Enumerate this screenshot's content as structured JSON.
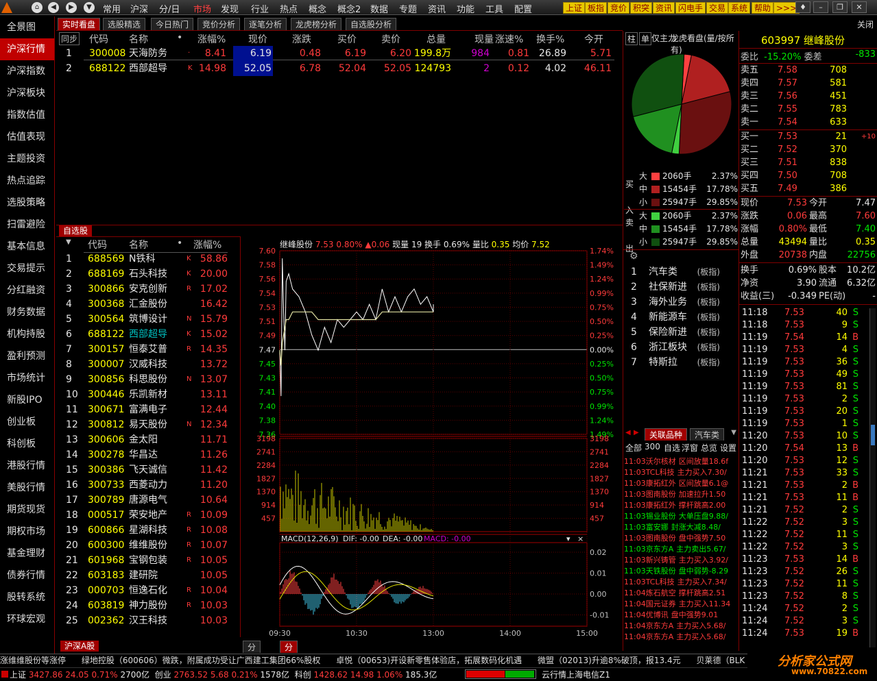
{
  "topbar": {
    "menus": [
      "常用",
      "沪深",
      "分/日",
      "市场",
      "发现",
      "行业",
      "热点",
      "概念",
      "概念2",
      "数据",
      "专题",
      "资讯",
      "功能",
      "工具",
      "配置"
    ],
    "active_menu": "市场",
    "right_buttons": [
      "上证",
      "板指",
      "竞价",
      "积突",
      "资讯",
      "闪电手",
      "交易",
      "系统",
      "帮助",
      ">>>"
    ],
    "close_label": "关闭"
  },
  "sidebar": {
    "items": [
      "全景图",
      "沪深行情",
      "沪深指数",
      "沪深板块",
      "指数估值",
      "估值表现",
      "主题投资",
      "热点追踪",
      "选股策略",
      "扫雷避险",
      "基本信息",
      "交易提示",
      "分红融资",
      "财务数据",
      "机构持股",
      "盈利预测",
      "市场统计",
      "新股IPO",
      "创业板",
      "科创板",
      "港股行情",
      "美股行情",
      "期货现货",
      "期权市场",
      "基金理财",
      "债券行情",
      "股转系统",
      "环球宏观"
    ],
    "active": 1
  },
  "top_tabs": [
    "实时看盘",
    "选股精选",
    "今日热门",
    "竞价分析",
    "逐笔分析",
    "龙虎榜分析",
    "自选股分析"
  ],
  "watch_table": {
    "headers": [
      "同步",
      "代码",
      "名称",
      "•",
      "涨幅%",
      "现价",
      "涨跌",
      "买价",
      "卖价",
      "总量",
      "现量",
      "涨速%",
      "换手%",
      "今开"
    ],
    "rows": [
      {
        "idx": "1",
        "code": "300008",
        "name": "天海防务",
        "flag": "·",
        "pct": "8.41",
        "price": "6.19",
        "chg": "0.48",
        "bid": "6.19",
        "ask": "6.20",
        "vol": "199.8万",
        "cur": "984",
        "speed": "0.81",
        "turn": "26.89",
        "open": "5.71"
      },
      {
        "idx": "2",
        "code": "688122",
        "name": "西部超导",
        "flag": "K",
        "pct": "14.98",
        "price": "52.05",
        "chg": "6.78",
        "bid": "52.04",
        "ask": "52.05",
        "vol": "124793",
        "cur": "2",
        "speed": "0.12",
        "turn": "4.02",
        "open": "46.11"
      }
    ]
  },
  "self_panel": {
    "title": "自选股",
    "headers": [
      "代码",
      "名称",
      "•",
      "涨幅%"
    ],
    "rows": [
      {
        "idx": "1",
        "code": "688569",
        "name": "N铁科",
        "flag": "K",
        "pct": "58.86"
      },
      {
        "idx": "2",
        "code": "688169",
        "name": "石头科技",
        "flag": "K",
        "pct": "20.00"
      },
      {
        "idx": "3",
        "code": "300866",
        "name": "安克创新",
        "flag": "R",
        "pct": "17.02"
      },
      {
        "idx": "4",
        "code": "300368",
        "name": "汇金股份",
        "flag": "",
        "pct": "16.42"
      },
      {
        "idx": "5",
        "code": "300564",
        "name": "筑博设计",
        "flag": "N",
        "pct": "15.79"
      },
      {
        "idx": "6",
        "code": "688122",
        "name": "西部超导",
        "flag": "K",
        "pct": "15.02"
      },
      {
        "idx": "7",
        "code": "300157",
        "name": "恒泰艾普",
        "flag": "R",
        "pct": "14.35"
      },
      {
        "idx": "8",
        "code": "300007",
        "name": "汉威科技",
        "flag": "",
        "pct": "13.72"
      },
      {
        "idx": "9",
        "code": "300856",
        "name": "科思股份",
        "flag": "N",
        "pct": "13.07"
      },
      {
        "idx": "10",
        "code": "300446",
        "name": "乐凯新材",
        "flag": "",
        "pct": "13.11"
      },
      {
        "idx": "11",
        "code": "300671",
        "name": "富满电子",
        "flag": "",
        "pct": "12.44"
      },
      {
        "idx": "12",
        "code": "300812",
        "name": "易天股份",
        "flag": "N",
        "pct": "12.34"
      },
      {
        "idx": "13",
        "code": "300606",
        "name": "金太阳",
        "flag": "",
        "pct": "11.71"
      },
      {
        "idx": "14",
        "code": "300278",
        "name": "华昌达",
        "flag": "",
        "pct": "11.26"
      },
      {
        "idx": "15",
        "code": "300386",
        "name": "飞天诚信",
        "flag": "",
        "pct": "11.42"
      },
      {
        "idx": "16",
        "code": "300733",
        "name": "西菱动力",
        "flag": "",
        "pct": "11.20"
      },
      {
        "idx": "17",
        "code": "300789",
        "name": "唐源电气",
        "flag": "",
        "pct": "10.64"
      },
      {
        "idx": "18",
        "code": "000517",
        "name": "荣安地产",
        "flag": "R",
        "pct": "10.09"
      },
      {
        "idx": "19",
        "code": "600866",
        "name": "星湖科技",
        "flag": "R",
        "pct": "10.08"
      },
      {
        "idx": "20",
        "code": "600300",
        "name": "维维股份",
        "flag": "R",
        "pct": "10.07"
      },
      {
        "idx": "21",
        "code": "601968",
        "name": "宝钢包装",
        "flag": "R",
        "pct": "10.05"
      },
      {
        "idx": "22",
        "code": "603183",
        "name": "建研院",
        "flag": "",
        "pct": "10.05"
      },
      {
        "idx": "23",
        "code": "000703",
        "name": "恒逸石化",
        "flag": "R",
        "pct": "10.04"
      },
      {
        "idx": "24",
        "code": "603819",
        "name": "神力股份",
        "flag": "R",
        "pct": "10.03"
      },
      {
        "idx": "25",
        "code": "002362",
        "name": "汉王科技",
        "flag": "",
        "pct": "10.03"
      }
    ],
    "bottom_tab": "沪深A股"
  },
  "intraday": {
    "header": {
      "name": "继峰股份",
      "price": "7.53",
      "pct": "0.80%",
      "chg": "▲0.06",
      "cur_vol": "现量 19",
      "turnover": "换手 0.69%",
      "vol_ratio_label": "量比",
      "vol_ratio": "0.35",
      "avg_label": "均价",
      "avg": "7.52"
    },
    "price_ticks": [
      "7.60",
      "7.58",
      "7.56",
      "7.54",
      "7.53",
      "7.51",
      "7.49",
      "7.47",
      "7.45",
      "7.43",
      "7.41",
      "7.40",
      "7.38",
      "7.36"
    ],
    "pct_ticks": [
      "1.74%",
      "1.49%",
      "1.24%",
      "0.99%",
      "0.75%",
      "0.50%",
      "0.25%",
      "0.00%",
      "0.25%",
      "0.50%",
      "0.75%",
      "0.99%",
      "1.24%",
      "1.49%"
    ],
    "vol_ticks": [
      "3198",
      "2741",
      "2284",
      "1827",
      "1370",
      "914",
      "457"
    ],
    "macd_header": {
      "label": "MACD(12,26,9)",
      "dif": "DIF: -0.00",
      "dea": "DEA: -0.00",
      "macd": "MACD: -0.00"
    },
    "macd_ticks": [
      "0.02",
      "0.01",
      "0.00",
      "-0.01"
    ],
    "time_ticks": [
      "09:30",
      "10:30",
      "13:00",
      "14:00",
      "15:00"
    ],
    "bottom_tabs": [
      "分析图",
      "分时图"
    ]
  },
  "chart_data": {
    "type": "line",
    "title": "继峰股份",
    "x_label": "",
    "y_label": "",
    "ylim": [
      7.36,
      7.6
    ],
    "x": [
      "09:30",
      "09:31",
      "09:32",
      "09:33",
      "09:34",
      "09:35",
      "09:37",
      "09:40",
      "09:45",
      "09:50",
      "09:55",
      "10:00",
      "10:05",
      "10:10",
      "10:15",
      "10:20",
      "10:25",
      "10:30",
      "10:35",
      "10:40",
      "10:45",
      "10:50",
      "10:55",
      "11:00",
      "11:05",
      "11:10",
      "11:15",
      "11:20",
      "11:25",
      "11:30",
      "13:00"
    ],
    "series": [
      {
        "name": "",
        "values": [
          7.47,
          7.41,
          7.59,
          7.52,
          7.47,
          7.56,
          7.57,
          7.55,
          7.54,
          7.52,
          7.49,
          7.47,
          7.5,
          7.48,
          7.51,
          7.5,
          7.51,
          7.52,
          7.51,
          7.53,
          7.51,
          7.55,
          7.52,
          7.54,
          7.52,
          7.54,
          7.55,
          7.53,
          7.54,
          7.52,
          7.53
        ]
      },
      {
        "name": "",
        "values": [
          7.47,
          7.45,
          7.48,
          7.49,
          7.5,
          7.51,
          7.51,
          7.52,
          7.52,
          7.52,
          7.52,
          7.51,
          7.51,
          7.51,
          7.51,
          7.51,
          7.51,
          7.51,
          7.51,
          7.51,
          7.51,
          7.52,
          7.52,
          7.52,
          7.52,
          7.52,
          7.52,
          7.52,
          7.52,
          7.52,
          7.52
        ]
      }
    ]
  },
  "mid_panel": {
    "tabs": [
      "柱",
      "单",
      "仅主力",
      "龙虎看盘(量/按所有)"
    ],
    "pie": [
      {
        "label": "大",
        "color": "#ff4040",
        "value": 2.37
      },
      {
        "label": "中",
        "color": "#b02020",
        "value": 17.78
      },
      {
        "label": "小",
        "color": "#6a1010",
        "value": 29.85
      },
      {
        "label": "大",
        "color": "#40d040",
        "value": 2.37
      },
      {
        "label": "中",
        "color": "#209020",
        "value": 17.78
      },
      {
        "label": "小",
        "color": "#105010",
        "value": 29.85
      }
    ],
    "buy_label": "买入",
    "sell_label": "卖出",
    "buy_rows": [
      {
        "size": "大",
        "vol": "2060手",
        "pct": "2.37%",
        "color": "#ff4040"
      },
      {
        "size": "中",
        "vol": "15454手",
        "pct": "17.78%",
        "color": "#b02020"
      },
      {
        "size": "小",
        "vol": "25947手",
        "pct": "29.85%",
        "color": "#6a1010"
      }
    ],
    "sell_rows": [
      {
        "size": "大",
        "vol": "2060手",
        "pct": "2.37%",
        "color": "#40d040"
      },
      {
        "size": "中",
        "vol": "15454手",
        "pct": "17.78%",
        "color": "#209020"
      },
      {
        "size": "小",
        "vol": "25947手",
        "pct": "29.85%",
        "color": "#105010"
      }
    ],
    "sectors": [
      {
        "idx": "1",
        "name": "汽车类",
        "type": "(板指)"
      },
      {
        "idx": "2",
        "name": "社保新进",
        "type": "(板指)"
      },
      {
        "idx": "3",
        "name": "海外业务",
        "type": "(板指)"
      },
      {
        "idx": "4",
        "name": "新能源车",
        "type": "(板指)"
      },
      {
        "idx": "5",
        "name": "保险新进",
        "type": "(板指)"
      },
      {
        "idx": "6",
        "name": "浙江板块",
        "type": "(板指)"
      },
      {
        "idx": "7",
        "name": "特斯拉",
        "type": "(板指)"
      }
    ],
    "related_tabs": [
      "关联品种",
      "汽车类"
    ],
    "filter_tabs": [
      "全部",
      "300",
      "自选",
      "浮窗",
      "总览",
      "设置"
    ],
    "news": [
      {
        "time": "11:03",
        "name": "沃尔核材",
        "event": "区间放量",
        "val": "18.6f",
        "color": "red"
      },
      {
        "time": "11:03",
        "name": "TCL科技",
        "event": "主力买入",
        "val": "7.30/",
        "color": "red"
      },
      {
        "time": "11:03",
        "name": "康拓红外",
        "event": "区间放量",
        "val": "6.1@",
        "color": "red"
      },
      {
        "time": "11:03",
        "name": "图南股份",
        "event": "加速拉升",
        "val": "1.50",
        "color": "red"
      },
      {
        "time": "11:03",
        "name": "康拓红外",
        "event": "撑杆跳高",
        "val": "2.00",
        "color": "red"
      },
      {
        "time": "11:03",
        "name": "锡业股份",
        "event": "大单压盘",
        "val": "9.88/",
        "color": "green"
      },
      {
        "time": "11:03",
        "name": "富安娜",
        "event": "封涨大减",
        "val": "8.48/",
        "color": "green"
      },
      {
        "time": "11:03",
        "name": "图南股份",
        "event": "盘中强势",
        "val": "7.50",
        "color": "red"
      },
      {
        "time": "11:03",
        "name": "京东方A",
        "event": "主力卖出",
        "val": "5.67/",
        "color": "green"
      },
      {
        "time": "11:03",
        "name": "新兴铸管",
        "event": "主力买入",
        "val": "3.92/",
        "color": "red"
      },
      {
        "time": "11:03",
        "name": "天铁股份",
        "event": "盘中弱势",
        "val": "-8.29",
        "color": "green"
      },
      {
        "time": "11:03",
        "name": "TCL科技",
        "event": "主力买入",
        "val": "7.34/",
        "color": "red"
      },
      {
        "time": "11:04",
        "name": "炼石航空",
        "event": "撑杆跳高",
        "val": "2.51",
        "color": "red"
      },
      {
        "time": "11:04",
        "name": "国元证券",
        "event": "主力买入",
        "val": "11.34",
        "color": "red"
      },
      {
        "time": "11:04",
        "name": "优博讯",
        "event": "盘中强势",
        "val": "9.01",
        "color": "red"
      },
      {
        "time": "11:04",
        "name": "京东方A",
        "event": "主力买入",
        "val": "5.68/",
        "color": "red"
      },
      {
        "time": "11:04",
        "name": "京东方A",
        "event": "主力买入",
        "val": "5.68/",
        "color": "red"
      }
    ]
  },
  "quote": {
    "code_name": "603997 继峰股份",
    "weibi_label": "委比",
    "weibi": "-15.20%",
    "weicha_label": "委差",
    "weicha": "-833",
    "asks": [
      {
        "label": "卖五",
        "price": "7.58",
        "vol": "708"
      },
      {
        "label": "卖四",
        "price": "7.57",
        "vol": "581"
      },
      {
        "label": "卖三",
        "price": "7.56",
        "vol": "451"
      },
      {
        "label": "卖二",
        "price": "7.55",
        "vol": "783"
      },
      {
        "label": "卖一",
        "price": "7.54",
        "vol": "633"
      }
    ],
    "bids": [
      {
        "label": "买一",
        "price": "7.53",
        "vol": "21",
        "extra": "+10"
      },
      {
        "label": "买二",
        "price": "7.52",
        "vol": "370",
        "extra": ""
      },
      {
        "label": "买三",
        "price": "7.51",
        "vol": "838",
        "extra": ""
      },
      {
        "label": "买四",
        "price": "7.50",
        "vol": "708",
        "extra": ""
      },
      {
        "label": "买五",
        "price": "7.49",
        "vol": "386",
        "extra": ""
      }
    ],
    "stats": [
      {
        "l1": "现价",
        "v1": "7.53",
        "c1": "red",
        "l2": "今开",
        "v2": "7.47",
        "c2": "white"
      },
      {
        "l1": "涨跌",
        "v1": "0.06",
        "c1": "red",
        "l2": "最高",
        "v2": "7.60",
        "c2": "red"
      },
      {
        "l1": "涨幅",
        "v1": "0.80%",
        "c1": "red",
        "l2": "最低",
        "v2": "7.40",
        "c2": "green"
      },
      {
        "l1": "总量",
        "v1": "43494",
        "c1": "yellow",
        "l2": "量比",
        "v2": "0.35",
        "c2": "yellow"
      },
      {
        "l1": "外盘",
        "v1": "20738",
        "c1": "red",
        "l2": "内盘",
        "v2": "22756",
        "c2": "green"
      }
    ],
    "stats2": [
      {
        "l1": "换手",
        "v1": "0.69%",
        "l2": "股本",
        "v2": "10.2亿"
      },
      {
        "l1": "净资",
        "v1": "3.90",
        "l2": "流通",
        "v2": "6.32亿"
      },
      {
        "l1": "收益(三)",
        "v1": "-0.349",
        "l2": "PE(动)",
        "v2": "-"
      }
    ],
    "ticks": [
      {
        "t": "11:18",
        "p": "7.53",
        "v": "40",
        "s": "S"
      },
      {
        "t": "11:18",
        "p": "7.53",
        "v": "9",
        "s": "S"
      },
      {
        "t": "11:19",
        "p": "7.54",
        "v": "14",
        "s": "B"
      },
      {
        "t": "11:19",
        "p": "7.53",
        "v": "4",
        "s": "S"
      },
      {
        "t": "11:19",
        "p": "7.53",
        "v": "36",
        "s": "S"
      },
      {
        "t": "11:19",
        "p": "7.53",
        "v": "49",
        "s": "S"
      },
      {
        "t": "11:19",
        "p": "7.53",
        "v": "81",
        "s": "S"
      },
      {
        "t": "11:19",
        "p": "7.53",
        "v": "2",
        "s": "S"
      },
      {
        "t": "11:19",
        "p": "7.53",
        "v": "20",
        "s": "S"
      },
      {
        "t": "11:19",
        "p": "7.53",
        "v": "1",
        "s": "S"
      },
      {
        "t": "11:20",
        "p": "7.53",
        "v": "10",
        "s": "S"
      },
      {
        "t": "11:20",
        "p": "7.54",
        "v": "13",
        "s": "B"
      },
      {
        "t": "11:20",
        "p": "7.53",
        "v": "12",
        "s": "S"
      },
      {
        "t": "11:21",
        "p": "7.53",
        "v": "33",
        "s": "S"
      },
      {
        "t": "11:21",
        "p": "7.53",
        "v": "2",
        "s": "B"
      },
      {
        "t": "11:21",
        "p": "7.53",
        "v": "11",
        "s": "B"
      },
      {
        "t": "11:21",
        "p": "7.52",
        "v": "2",
        "s": "S"
      },
      {
        "t": "11:22",
        "p": "7.52",
        "v": "3",
        "s": "S"
      },
      {
        "t": "11:22",
        "p": "7.52",
        "v": "11",
        "s": "S"
      },
      {
        "t": "11:22",
        "p": "7.52",
        "v": "3",
        "s": "S"
      },
      {
        "t": "11:23",
        "p": "7.53",
        "v": "14",
        "s": "B"
      },
      {
        "t": "11:23",
        "p": "7.52",
        "v": "26",
        "s": "S"
      },
      {
        "t": "11:23",
        "p": "7.52",
        "v": "11",
        "s": "S"
      },
      {
        "t": "11:23",
        "p": "7.52",
        "v": "8",
        "s": "S"
      },
      {
        "t": "11:24",
        "p": "7.52",
        "v": "2",
        "s": "S"
      },
      {
        "t": "11:24",
        "p": "7.52",
        "v": "3",
        "s": "S"
      },
      {
        "t": "11:24",
        "p": "7.53",
        "v": "19",
        "s": "B"
      }
    ]
  },
  "ticker_news": "涨维维股份等涨停      绿地控股（600606）微跌，附属成功受让广西建工集团66%股权      卓悦（00653)开设新零售体验店，拓展数码化机遇      微盟（02013)升逾8%破顶，报13.4元      贝莱德（BLK",
  "status": {
    "idx1_name": "上证",
    "idx1_val": "3427.86",
    "idx1_chg": "24.05",
    "idx1_pct": "0.71%",
    "idx1_amt": "2700亿",
    "idx2_name": "创业",
    "idx2_val": "2763.52",
    "idx2_chg": "5.68",
    "idx2_pct": "0.21%",
    "idx2_amt": "1578亿",
    "idx3_name": "科创",
    "idx3_val": "1428.62",
    "idx3_chg": "14.98",
    "idx3_pct": "1.06%",
    "idx3_amt": "185.3亿",
    "server": "云行情上海电信Z1",
    "watermark": "分析家公式网",
    "watermark_url": "www.70822.com"
  }
}
